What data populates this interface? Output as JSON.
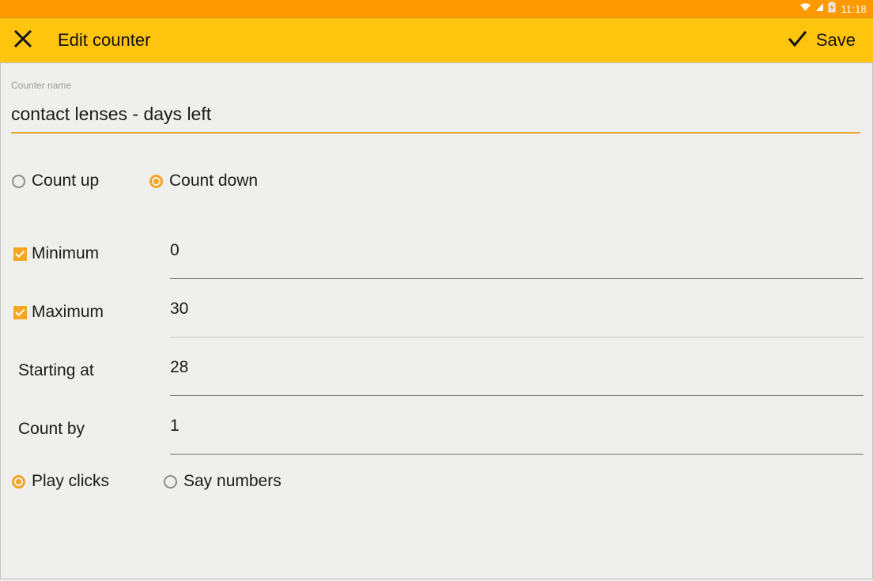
{
  "status_bar": {
    "time": "11:18",
    "icons": [
      "wifi-icon",
      "signal-icon",
      "battery-charging-icon"
    ],
    "background": "#fe9a00",
    "text_color": "#ffffff"
  },
  "app_bar": {
    "title": "Edit counter",
    "close_icon": "close-icon",
    "save_icon": "check-icon",
    "save_label": "Save",
    "background": "#ffc40d",
    "text_color": "#121212"
  },
  "form": {
    "name_field": {
      "caption": "Counter name",
      "value": "contact lenses - days left",
      "underline_color": "#e9a73a"
    },
    "direction": {
      "options": [
        {
          "label": "Count up",
          "selected": false
        },
        {
          "label": "Count down",
          "selected": true
        }
      ]
    },
    "numeric_rows": [
      {
        "label": "Minimum",
        "has_checkbox": true,
        "checked": true,
        "value": "0",
        "underline": "dark"
      },
      {
        "label": "Maximum",
        "has_checkbox": true,
        "checked": true,
        "value": "30",
        "underline": "light"
      },
      {
        "label": "Starting at",
        "has_checkbox": false,
        "checked": false,
        "value": "28",
        "underline": "dark"
      },
      {
        "label": "Count by",
        "has_checkbox": false,
        "checked": false,
        "value": "1",
        "underline": "dark"
      }
    ],
    "sound": {
      "options": [
        {
          "label": "Play clicks",
          "selected": true
        },
        {
          "label": "Say numbers",
          "selected": false
        }
      ]
    }
  },
  "accent_color": "#f5a623",
  "background_color": "#efefee"
}
